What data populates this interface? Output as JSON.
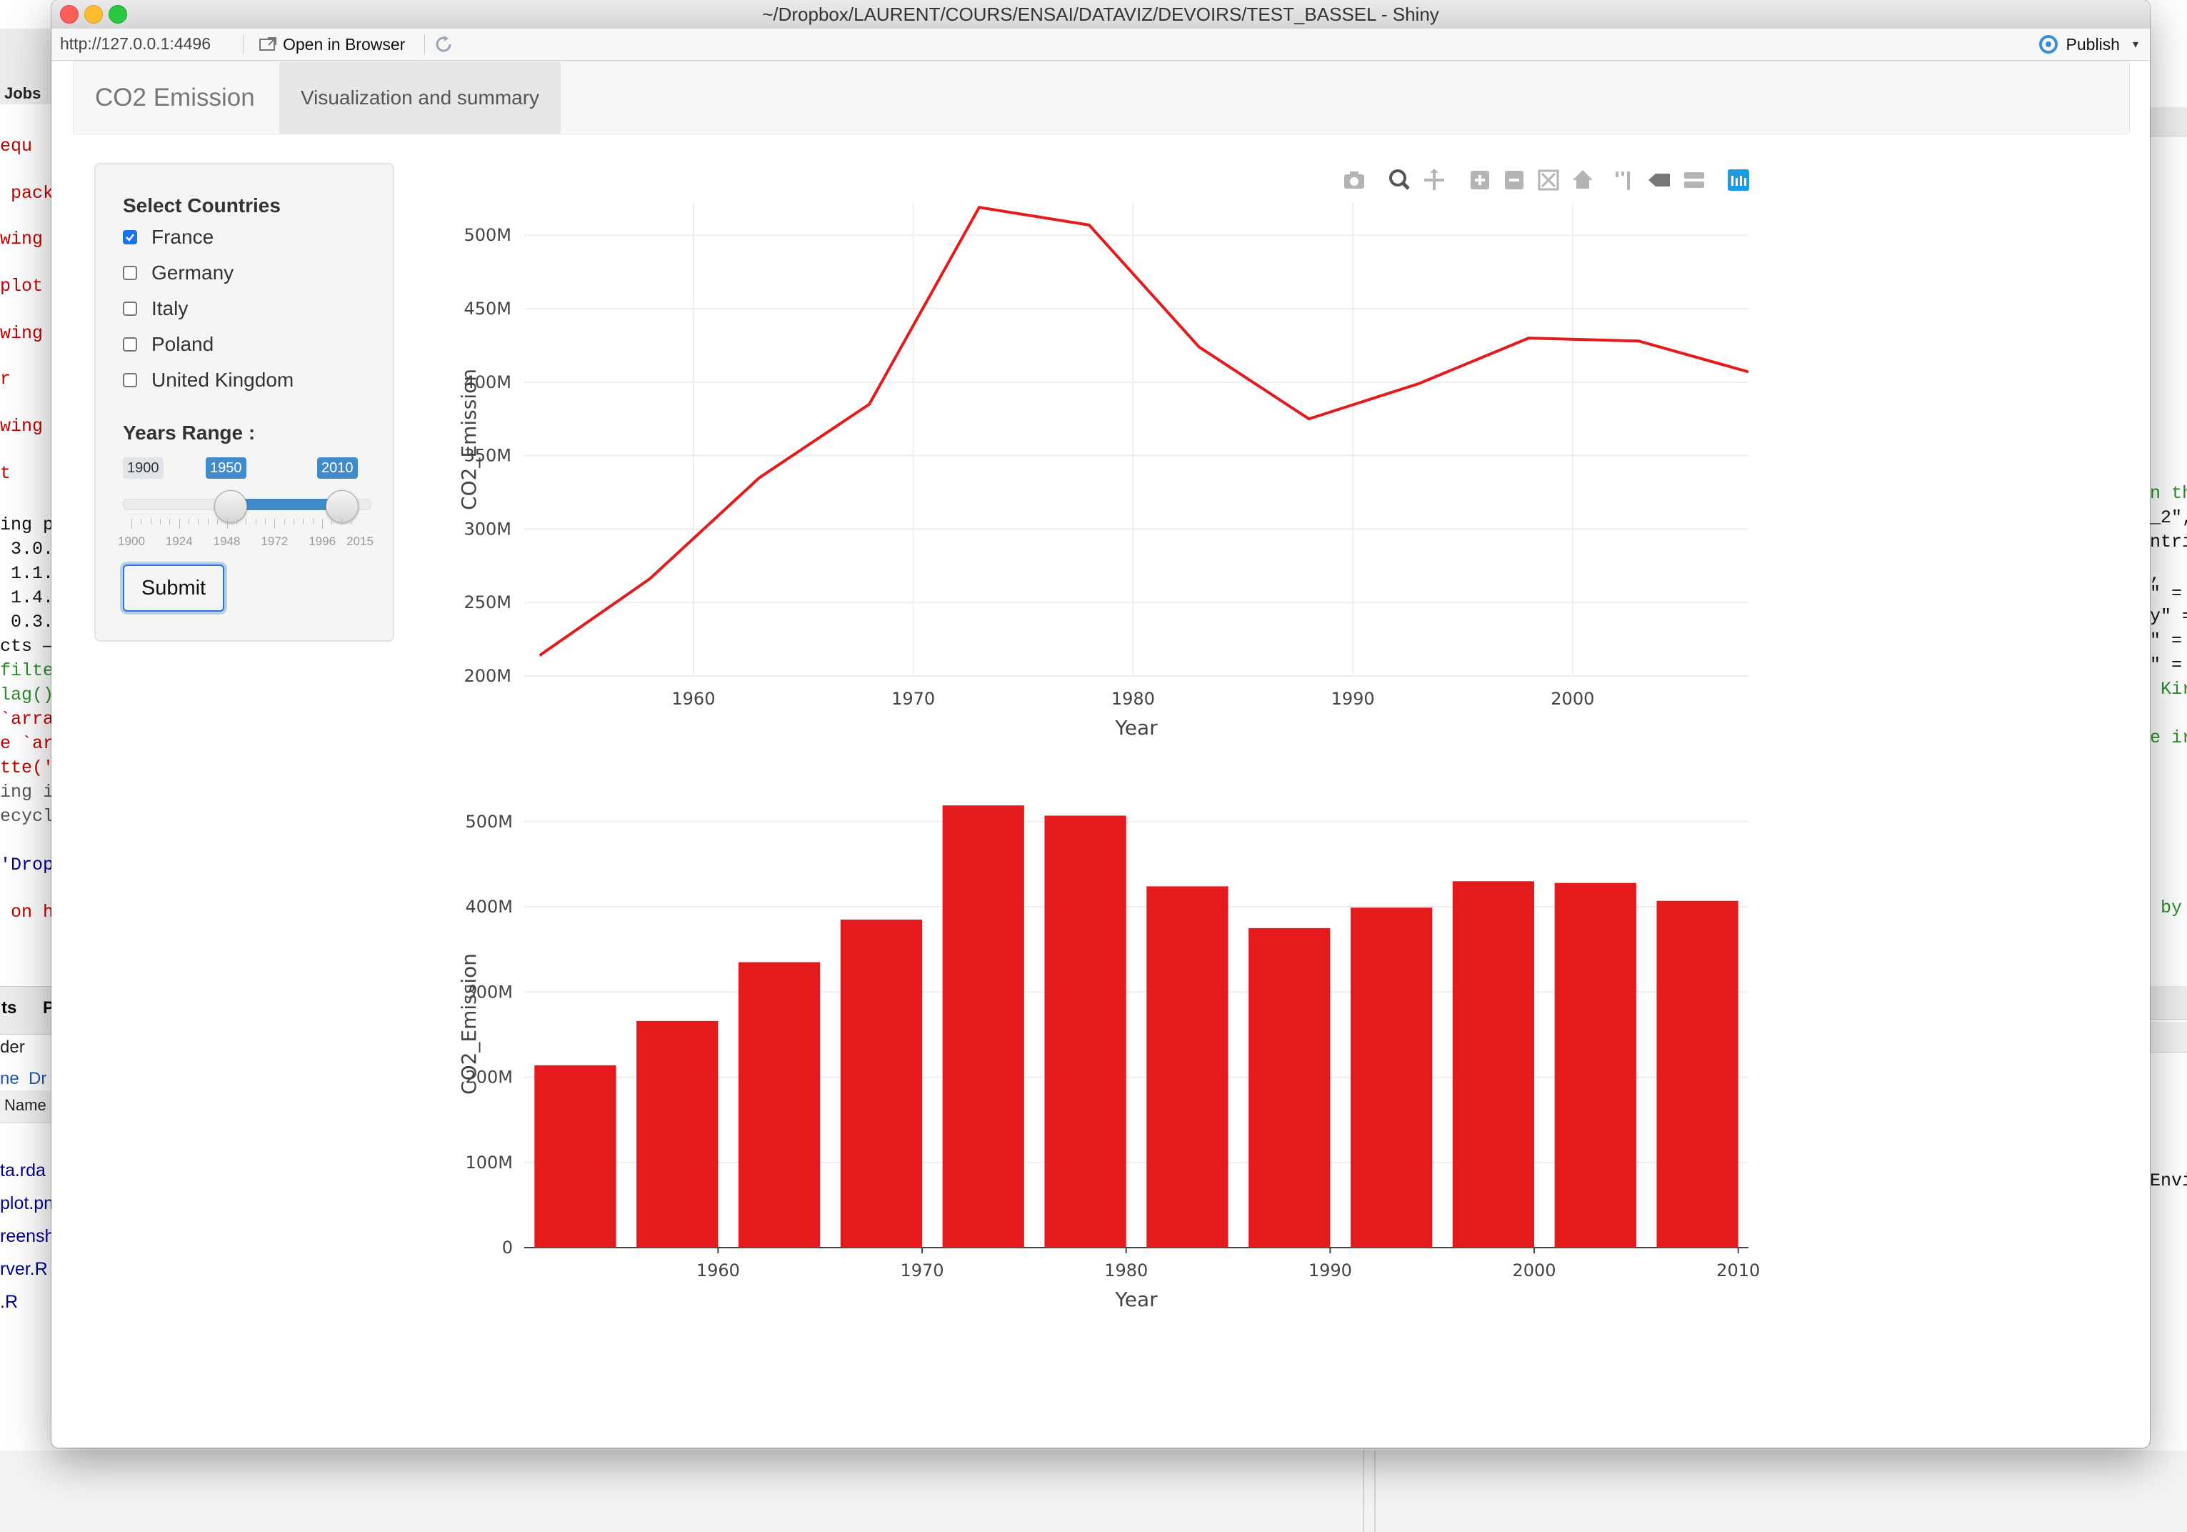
{
  "window": {
    "title": "~/Dropbox/LAURENT/COURS/ENSAI/DATAVIZ/DEVOIRS/TEST_BASSEL - Shiny"
  },
  "toolbar": {
    "url": "http://127.0.0.1:4496",
    "open_in_browser": "Open in Browser",
    "publish": "Publish"
  },
  "navbar": {
    "brand": "CO2 Emission",
    "tab": "Visualization and summary"
  },
  "sidebar": {
    "select_countries_label": "Select Countries",
    "countries": [
      {
        "label": "France",
        "checked": true
      },
      {
        "label": "Germany",
        "checked": false
      },
      {
        "label": "Italy",
        "checked": false
      },
      {
        "label": "Poland",
        "checked": false
      },
      {
        "label": "United Kingdom",
        "checked": false
      }
    ],
    "years_range_label": "Years Range :",
    "slider": {
      "min_label": "1900",
      "from_label": "1950",
      "to_label": "2010",
      "min": 1900,
      "max": 2015,
      "from": 1950,
      "to": 2010,
      "tick_labels": [
        "1900",
        "1924",
        "1948",
        "1972",
        "1996",
        "2015"
      ]
    },
    "submit_label": "Submit"
  },
  "colors": {
    "series": "#e41a1c",
    "slider_accent": "#428bca",
    "modebar_active": "#1a9be6"
  },
  "modebar": {
    "icons": [
      "camera-icon",
      "zoom-icon",
      "pan-icon",
      "zoom-in-icon",
      "zoom-out-icon",
      "autoscale-icon",
      "reset-axes-icon",
      "spike-lines-icon",
      "hover-closest-icon",
      "hover-compare-icon",
      "plotly-logo-icon"
    ]
  },
  "background": {
    "left_code": [
      {
        "text": "equ",
        "color": "#c00000"
      },
      {
        "text": " pack",
        "color": "#c00000"
      },
      {
        "text": "wing",
        "color": "#c00000"
      },
      {
        "text": "plot",
        "color": "#c00000"
      },
      {
        "text": "wing",
        "color": "#c00000"
      },
      {
        "text": "r",
        "color": "#c00000"
      },
      {
        "text": "wing",
        "color": "#c00000"
      },
      {
        "text": "t",
        "color": "#c00000"
      },
      {
        "text": "ing p",
        "color": "#111111"
      },
      {
        "text": " 3.0.",
        "color": "#111111"
      },
      {
        "text": " 1.1.",
        "color": "#111111"
      },
      {
        "text": " 1.4.",
        "color": "#111111"
      },
      {
        "text": " 0.3.",
        "color": "#111111"
      },
      {
        "text": "cts —",
        "color": "#111111"
      },
      {
        "text": "filte",
        "color": "#2e8b2e"
      },
      {
        "text": "lag()",
        "color": "#2e8b2e"
      },
      {
        "text": "`arra",
        "color": "#c00000"
      },
      {
        "text": "e `ar",
        "color": "#c00000"
      },
      {
        "text": "tte('",
        "color": "#c00000"
      },
      {
        "text": "ing i",
        "color": "#555555"
      },
      {
        "text": "ecycl",
        "color": "#555555"
      },
      {
        "text": "'Drop",
        "color": "#00008b"
      },
      {
        "text": " on h",
        "color": "#c00000"
      }
    ],
    "left_pane": {
      "jobs_tab": "Jobs",
      "tab_ts": "ts",
      "tab_p": "P",
      "der": "der",
      "breadcrumb": "ne  Dr",
      "name_header": "Name",
      "files": [
        "ta.rda",
        "plot.pn",
        "reensh",
        "rver.R",
        ".R"
      ]
    },
    "right_code": [
      {
        "text": "n th",
        "color": "#2e8b2e"
      },
      {
        "text": "_2\",",
        "color": "#111111"
      },
      {
        "text": "ntri",
        "color": "#111111"
      },
      {
        "text": ",",
        "color": "#111111"
      },
      {
        "text": "\" =",
        "color": "#111111"
      },
      {
        "text": "y\" =",
        "color": "#111111"
      },
      {
        "text": "\" = \"",
        "color": "#111111"
      },
      {
        "text": "\" =",
        "color": "#111111"
      },
      {
        "text": " Kir",
        "color": "#2e8b2e"
      },
      {
        "text": "e ir",
        "color": "#2e8b2e"
      },
      {
        "text": " by",
        "color": "#2e8b2e"
      },
      {
        "text": "Envi",
        "color": "#111111"
      }
    ]
  },
  "chart_data": [
    {
      "type": "line",
      "title": "",
      "xlabel": "Year",
      "ylabel": "CO2_Emission",
      "x": [
        1953,
        1958,
        1963,
        1968,
        1973,
        1978,
        1983,
        1988,
        1993,
        1998,
        2003,
        2008
      ],
      "series": [
        {
          "values": [
            214,
            266,
            335,
            385,
            519,
            507,
            424,
            375,
            399,
            430,
            428,
            407
          ]
        }
      ],
      "value_unit": "M",
      "xlim": [
        1952.3,
        2008
      ],
      "ylim": [
        200,
        522
      ],
      "x_ticks": [
        "1960",
        "1970",
        "1980",
        "1990",
        "2000"
      ],
      "y_ticks": [
        "200M",
        "250M",
        "300M",
        "350M",
        "400M",
        "450M",
        "500M"
      ],
      "grid": true
    },
    {
      "type": "bar",
      "title": "",
      "xlabel": "Year",
      "ylabel": "CO2_Emission",
      "x": [
        1953,
        1958,
        1963,
        1968,
        1973,
        1978,
        1983,
        1988,
        1993,
        1998,
        2003,
        2008
      ],
      "series": [
        {
          "values": [
            214,
            266,
            335,
            385,
            519,
            507,
            424,
            375,
            399,
            430,
            428,
            407
          ]
        }
      ],
      "value_unit": "M",
      "xlim": [
        1950.5,
        2010.5
      ],
      "ylim": [
        0,
        525
      ],
      "x_ticks": [
        "1960",
        "1970",
        "1980",
        "1990",
        "2000",
        "2010"
      ],
      "y_ticks": [
        "0",
        "100M",
        "200M",
        "300M",
        "400M",
        "500M"
      ],
      "grid": true
    }
  ]
}
